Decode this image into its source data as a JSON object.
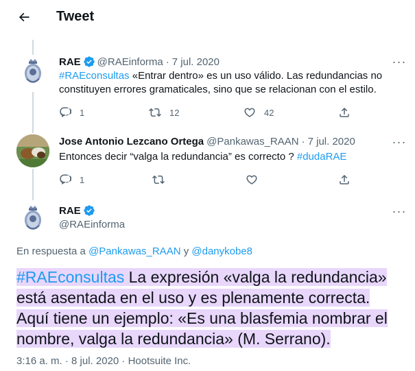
{
  "header": {
    "title": "Tweet"
  },
  "tweets": [
    {
      "name": "RAE",
      "handle": "@RAEinforma",
      "sep": "·",
      "date": "7 jul. 2020",
      "hashtag": "#RAEconsultas",
      "text_line1": " «Entrar dentro» es un uso válido. Las redundancias no",
      "text_line2": "constituyen errores gramaticales, sino que se relacionan con el estilo.",
      "replies": "1",
      "retweets": "12",
      "likes": "42"
    },
    {
      "name": "Jose Antonio Lezcano Ortega",
      "handle": "@Pankawas_RAAN",
      "sep": "·",
      "date": "7 jul. 2020",
      "text": "Entonces decir “valga la redundancia” es correcto ? ",
      "hashtag": "#dudaRAE",
      "replies": "1"
    }
  ],
  "main": {
    "name": "RAE",
    "handle": "@RAEinforma",
    "reply_prefix": "En respuesta a ",
    "reply_user1": "@Pankawas_RAAN",
    "reply_and": " y ",
    "reply_user2": "@danykobe8",
    "line1_hashtag": "#RAEconsultas",
    "line1_rest": " La expresión «valga la redundancia»",
    "line2": "está asentada en el uso y es plenamente correcta.",
    "line3": "Aquí tiene un ejemplo: «Es una blasfemia nombrar el",
    "line4": "nombre, valga la redundancia» (M. Serrano).",
    "meta": "3:16 a. m. · 8 jul. 2020 · Hootsuite Inc."
  },
  "colors": {
    "accent": "#1d9bf0",
    "highlight": "#e8d6fb",
    "muted": "#536471"
  }
}
